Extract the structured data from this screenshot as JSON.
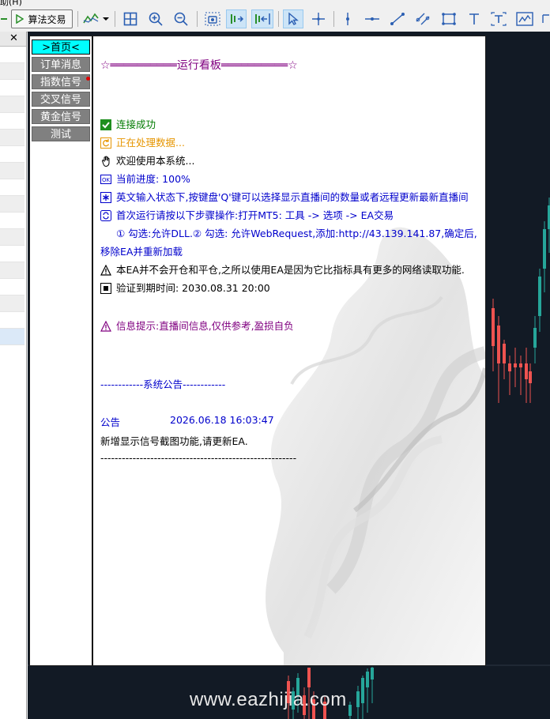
{
  "window": {
    "title_fragment": "助(H)"
  },
  "toolbar": {
    "algo_trading_label": "算法交易",
    "items": [
      "play-icon",
      "algo-trading-button",
      "indicator-icon",
      "grid-icon",
      "zoom-in-icon",
      "zoom-out-icon",
      "screenshot-icon",
      "auto-scroll-icon",
      "chart-shift-icon",
      "cursor-icon",
      "crosshair-icon",
      "vertical-line-icon",
      "horizontal-line-icon",
      "trend-line-icon",
      "channel-icon",
      "rectangle-icon",
      "text-icon",
      "text-label-icon",
      "chart-window-icon"
    ]
  },
  "left_panel": {
    "close_label": "✕"
  },
  "dashboard": {
    "menu": [
      {
        "label": ">首页<",
        "active": true
      },
      {
        "label": "订单消息",
        "active": false
      },
      {
        "label": "指数信号",
        "active": false,
        "badge": true
      },
      {
        "label": "交叉信号",
        "active": false
      },
      {
        "label": "黄金信号",
        "active": false
      },
      {
        "label": "测试",
        "active": false
      }
    ],
    "title": "☆══════════运行看板══════════☆",
    "lines": {
      "connected": "连接成功",
      "processing": "正在处理数据...",
      "welcome": "欢迎使用本系统...",
      "progress": "当前进度: 100%",
      "hint": "英文输入状态下,按键盘'Q'键可以选择显示直播间的数量或者远程更新最新直播间",
      "first_run": "首次运行请按以下步骤操作:打开MT5: 工具 -> 选项 -> EA交易",
      "steps": "① 勾选:允许DLL.② 勾选: 允许WebRequest,添加:http://43.139.141.87,确定后,",
      "reload": "移除EA并重新加载",
      "warning": "本EA并不会开仓和平仓,之所以使用EA是因为它比指标具有更多的网络读取功能.",
      "expiry": "验证到期时间: 2030.08.31 20:00",
      "risk": "信息提示:直播间信息,仅供参考,盈损自负"
    },
    "announcement": {
      "header": "------------系统公告------------",
      "label": "公告",
      "date": "2026.06.18 16:03:47",
      "text": "新增显示信号截图功能,请更新EA.",
      "divider": "-------------------------------------------------------"
    },
    "progress_percent": 100
  },
  "colors": {
    "green": "#007a00",
    "orange": "#e69500",
    "blue": "#0000cc",
    "purple": "#800080",
    "chart_bg": "#121a25",
    "candle_up": "#26a69a",
    "candle_down": "#ef5350",
    "menu_active": "#00ffff",
    "menu_bg": "#808080"
  },
  "watermark": "www.eazhijia.com"
}
